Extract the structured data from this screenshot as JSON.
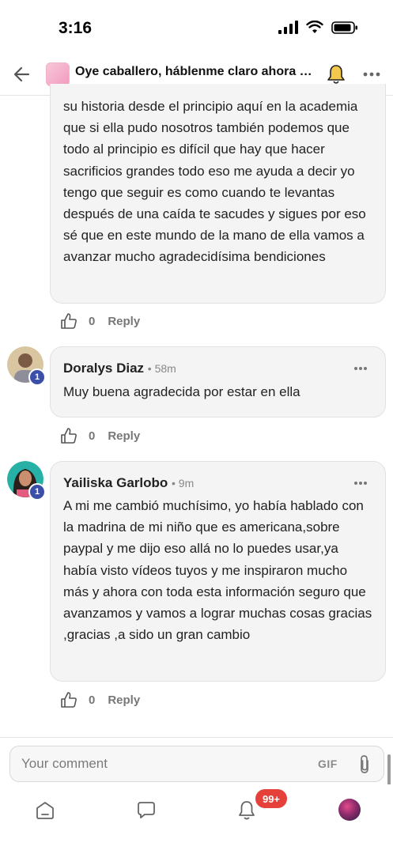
{
  "status": {
    "time": "3:16"
  },
  "header": {
    "title": "Oye caballero, háblenme claro ahora o c..."
  },
  "comments": [
    {
      "text": "su historia desde el principio aquí en la academia que si ella pudo nosotros también podemos que todo al principio es difícil que hay que hacer sacrificios grandes todo eso me ayuda a decir yo tengo que seguir es como cuando te levantas después de una caída te sacudes y sigues por eso sé que en este mundo de la mano de ella vamos a avanzar mucho agradecidísima bendiciones",
      "likes": "0",
      "reply_label": "Reply"
    },
    {
      "author": "Doralys Diaz",
      "ago": "• 58m",
      "level": "1",
      "text": "Muy buena agradecida por estar en ella",
      "likes": "0",
      "reply_label": "Reply"
    },
    {
      "author": "Yailiska Garlobo",
      "ago": "• 9m",
      "level": "1",
      "text": "A mi me cambió muchísimo, yo había hablado con la madrina de mi niño que es americana,sobre paypal y me dijo eso allá no lo puedes usar,ya había visto vídeos tuyos y me inspiraron mucho más y ahora con toda esta información seguro que avanzamos y vamos a lograr muchas cosas gracias ,gracias ,a sido un gran cambio",
      "likes": "0",
      "reply_label": "Reply"
    }
  ],
  "composer": {
    "placeholder": "Your comment",
    "gif_label": "GIF"
  },
  "bottom_nav": {
    "notifications_badge": "99+"
  },
  "colors": {
    "badge_red": "#e5413a",
    "level_badge": "#3b4fa8",
    "card_bg": "#f4f4f5"
  }
}
